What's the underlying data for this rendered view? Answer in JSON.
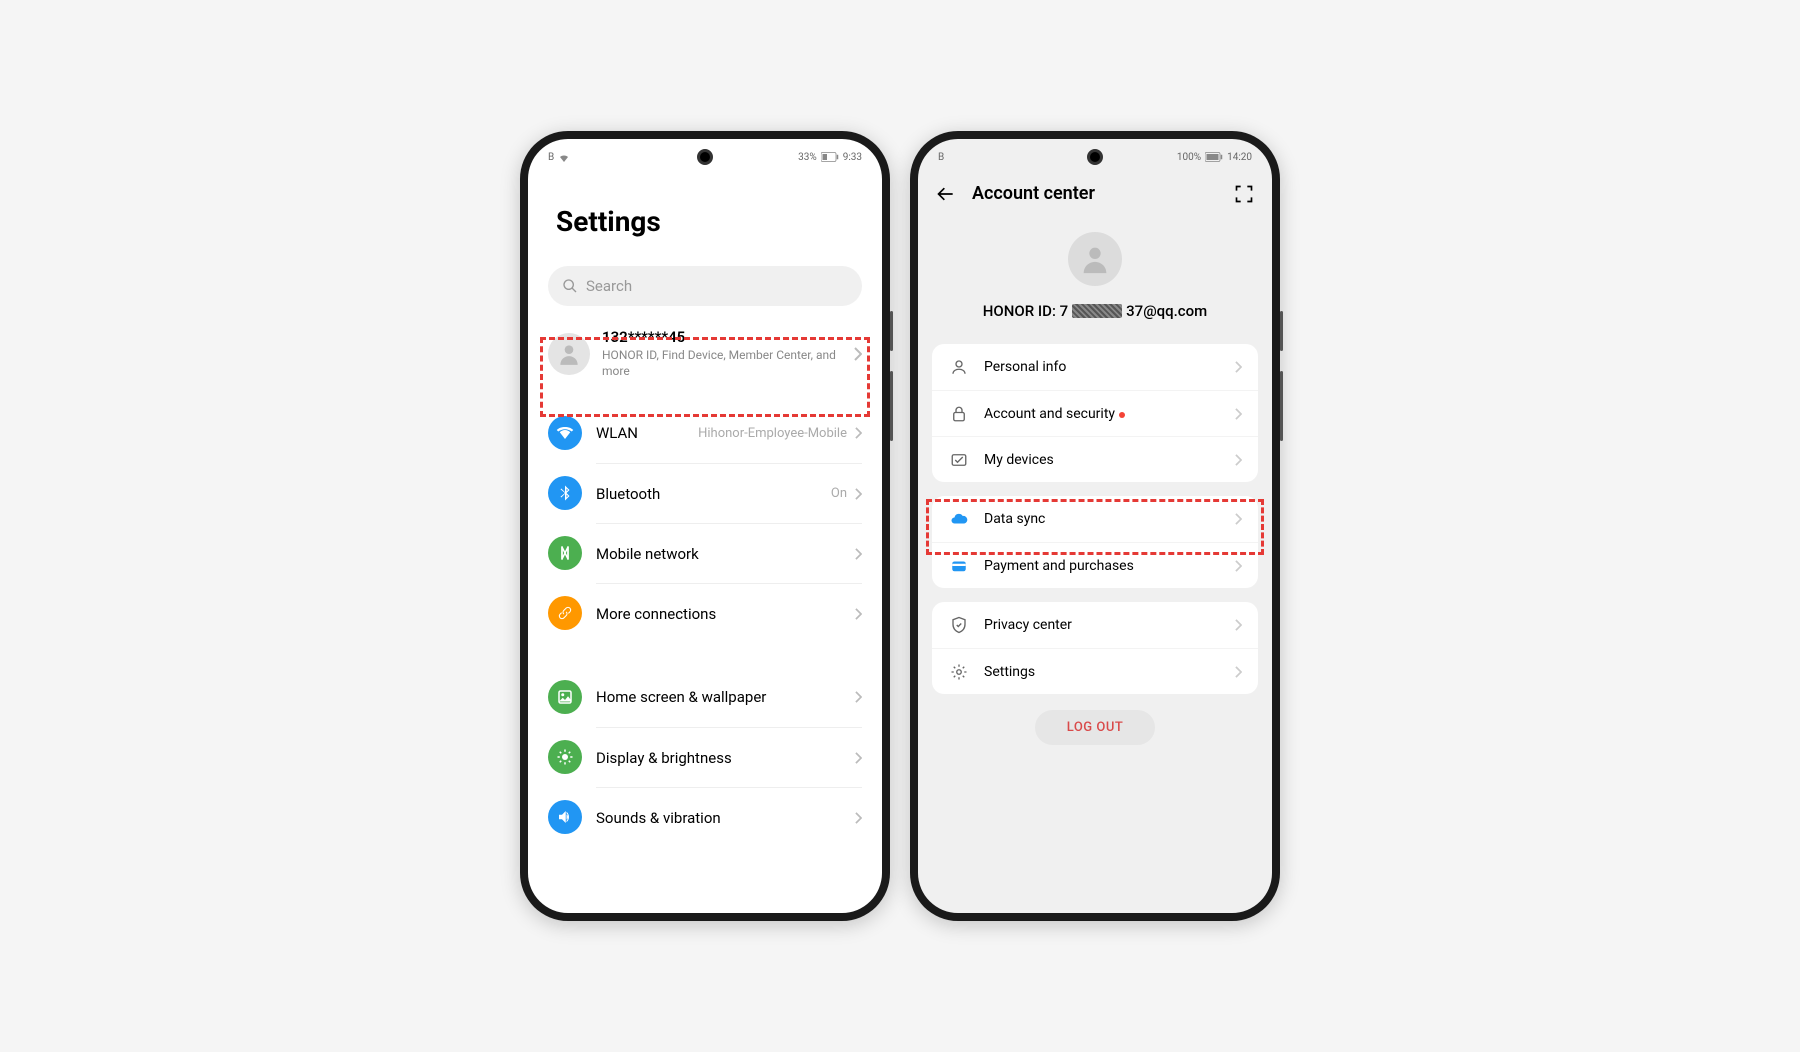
{
  "phoneA": {
    "status": {
      "left": "B",
      "battery": "33%",
      "time": "9:33"
    },
    "title": "Settings",
    "search_placeholder": "Search",
    "account": {
      "name": "132******45",
      "sub": "HONOR ID, Find Device, Member Center, and more"
    },
    "rows": {
      "wlan": {
        "label": "WLAN",
        "value": "Hihonor-Employee-Mobile"
      },
      "bluetooth": {
        "label": "Bluetooth",
        "value": "On"
      },
      "mobile": {
        "label": "Mobile network"
      },
      "connections": {
        "label": "More connections"
      },
      "home": {
        "label": "Home screen & wallpaper"
      },
      "display": {
        "label": "Display & brightness"
      },
      "sounds": {
        "label": "Sounds & vibration"
      }
    }
  },
  "phoneB": {
    "status": {
      "left": "B",
      "battery": "100%",
      "time": "14:20"
    },
    "header": "Account center",
    "honor_prefix": "HONOR ID: 7",
    "honor_suffix": "37@qq.com",
    "rows": {
      "personal": "Personal info",
      "security": "Account and security",
      "devices": "My devices",
      "datasync": "Data sync",
      "payment": "Payment and purchases",
      "privacy": "Privacy center",
      "settings": "Settings"
    },
    "logout": "LOG OUT"
  }
}
